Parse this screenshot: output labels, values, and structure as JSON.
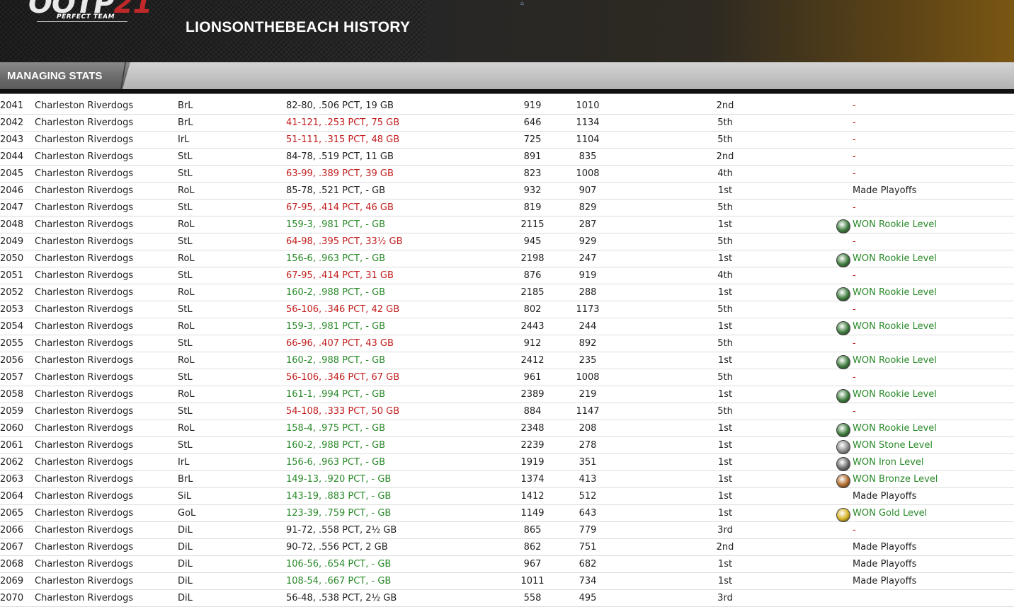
{
  "header": {
    "logo_main": "OOTP",
    "logo_num": "21",
    "logo_sub": "PERFECT TEAM",
    "title": "LIONSONTHEBEACH HISTORY"
  },
  "tabs": [
    {
      "label": "MANAGING STATS"
    }
  ],
  "colors": {
    "good": "#2a8a2a",
    "bad": "#c21d1d"
  },
  "rows": [
    {
      "year": "2041",
      "team": "Charleston Riverdogs",
      "league": "BrL",
      "record": "82-80, .506 PCT, 19 GB",
      "rs": "919",
      "ra": "1010",
      "pos": "2nd",
      "result": "-",
      "rec_class": "neutral",
      "res_class": "bad",
      "badge": ""
    },
    {
      "year": "2042",
      "team": "Charleston Riverdogs",
      "league": "BrL",
      "record": "41-121, .253 PCT, 75 GB",
      "rs": "646",
      "ra": "1134",
      "pos": "5th",
      "result": "-",
      "rec_class": "bad",
      "res_class": "bad",
      "badge": ""
    },
    {
      "year": "2043",
      "team": "Charleston Riverdogs",
      "league": "IrL",
      "record": "51-111, .315 PCT, 48 GB",
      "rs": "725",
      "ra": "1104",
      "pos": "5th",
      "result": "-",
      "rec_class": "bad",
      "res_class": "bad",
      "badge": ""
    },
    {
      "year": "2044",
      "team": "Charleston Riverdogs",
      "league": "StL",
      "record": "84-78, .519 PCT, 11 GB",
      "rs": "891",
      "ra": "835",
      "pos": "2nd",
      "result": "-",
      "rec_class": "neutral",
      "res_class": "bad",
      "badge": ""
    },
    {
      "year": "2045",
      "team": "Charleston Riverdogs",
      "league": "StL",
      "record": "63-99, .389 PCT, 39 GB",
      "rs": "823",
      "ra": "1008",
      "pos": "4th",
      "result": "-",
      "rec_class": "bad",
      "res_class": "bad",
      "badge": ""
    },
    {
      "year": "2046",
      "team": "Charleston Riverdogs",
      "league": "RoL",
      "record": "85-78, .521 PCT, - GB",
      "rs": "932",
      "ra": "907",
      "pos": "1st",
      "result": "Made Playoffs",
      "rec_class": "neutral",
      "res_class": "neutral",
      "badge": ""
    },
    {
      "year": "2047",
      "team": "Charleston Riverdogs",
      "league": "StL",
      "record": "67-95, .414 PCT, 46 GB",
      "rs": "819",
      "ra": "829",
      "pos": "5th",
      "result": "-",
      "rec_class": "bad",
      "res_class": "bad",
      "badge": ""
    },
    {
      "year": "2048",
      "team": "Charleston Riverdogs",
      "league": "RoL",
      "record": "159-3, .981 PCT, - GB",
      "rs": "2115",
      "ra": "287",
      "pos": "1st",
      "result": "WON Rookie Level",
      "rec_class": "good",
      "res_class": "good",
      "badge": "rookie"
    },
    {
      "year": "2049",
      "team": "Charleston Riverdogs",
      "league": "StL",
      "record": "64-98, .395 PCT, 33½ GB",
      "rs": "945",
      "ra": "929",
      "pos": "5th",
      "result": "-",
      "rec_class": "bad",
      "res_class": "bad",
      "badge": ""
    },
    {
      "year": "2050",
      "team": "Charleston Riverdogs",
      "league": "RoL",
      "record": "156-6, .963 PCT, - GB",
      "rs": "2198",
      "ra": "247",
      "pos": "1st",
      "result": "WON Rookie Level",
      "rec_class": "good",
      "res_class": "good",
      "badge": "rookie"
    },
    {
      "year": "2051",
      "team": "Charleston Riverdogs",
      "league": "StL",
      "record": "67-95, .414 PCT, 31 GB",
      "rs": "876",
      "ra": "919",
      "pos": "4th",
      "result": "-",
      "rec_class": "bad",
      "res_class": "bad",
      "badge": ""
    },
    {
      "year": "2052",
      "team": "Charleston Riverdogs",
      "league": "RoL",
      "record": "160-2, .988 PCT, - GB",
      "rs": "2185",
      "ra": "288",
      "pos": "1st",
      "result": "WON Rookie Level",
      "rec_class": "good",
      "res_class": "good",
      "badge": "rookie"
    },
    {
      "year": "2053",
      "team": "Charleston Riverdogs",
      "league": "StL",
      "record": "56-106, .346 PCT, 42 GB",
      "rs": "802",
      "ra": "1173",
      "pos": "5th",
      "result": "-",
      "rec_class": "bad",
      "res_class": "bad",
      "badge": ""
    },
    {
      "year": "2054",
      "team": "Charleston Riverdogs",
      "league": "RoL",
      "record": "159-3, .981 PCT, - GB",
      "rs": "2443",
      "ra": "244",
      "pos": "1st",
      "result": "WON Rookie Level",
      "rec_class": "good",
      "res_class": "good",
      "badge": "rookie"
    },
    {
      "year": "2055",
      "team": "Charleston Riverdogs",
      "league": "StL",
      "record": "66-96, .407 PCT, 43 GB",
      "rs": "912",
      "ra": "892",
      "pos": "5th",
      "result": "-",
      "rec_class": "bad",
      "res_class": "bad",
      "badge": ""
    },
    {
      "year": "2056",
      "team": "Charleston Riverdogs",
      "league": "RoL",
      "record": "160-2, .988 PCT, - GB",
      "rs": "2412",
      "ra": "235",
      "pos": "1st",
      "result": "WON Rookie Level",
      "rec_class": "good",
      "res_class": "good",
      "badge": "rookie"
    },
    {
      "year": "2057",
      "team": "Charleston Riverdogs",
      "league": "StL",
      "record": "56-106, .346 PCT, 67 GB",
      "rs": "961",
      "ra": "1008",
      "pos": "5th",
      "result": "-",
      "rec_class": "bad",
      "res_class": "bad",
      "badge": ""
    },
    {
      "year": "2058",
      "team": "Charleston Riverdogs",
      "league": "RoL",
      "record": "161-1, .994 PCT, - GB",
      "rs": "2389",
      "ra": "219",
      "pos": "1st",
      "result": "WON Rookie Level",
      "rec_class": "good",
      "res_class": "good",
      "badge": "rookie"
    },
    {
      "year": "2059",
      "team": "Charleston Riverdogs",
      "league": "StL",
      "record": "54-108, .333 PCT, 50 GB",
      "rs": "884",
      "ra": "1147",
      "pos": "5th",
      "result": "-",
      "rec_class": "bad",
      "res_class": "bad",
      "badge": ""
    },
    {
      "year": "2060",
      "team": "Charleston Riverdogs",
      "league": "RoL",
      "record": "158-4, .975 PCT, - GB",
      "rs": "2348",
      "ra": "208",
      "pos": "1st",
      "result": "WON Rookie Level",
      "rec_class": "good",
      "res_class": "good",
      "badge": "rookie"
    },
    {
      "year": "2061",
      "team": "Charleston Riverdogs",
      "league": "StL",
      "record": "160-2, .988 PCT, - GB",
      "rs": "2239",
      "ra": "278",
      "pos": "1st",
      "result": "WON Stone Level",
      "rec_class": "good",
      "res_class": "good",
      "badge": "stone"
    },
    {
      "year": "2062",
      "team": "Charleston Riverdogs",
      "league": "IrL",
      "record": "156-6, .963 PCT, - GB",
      "rs": "1919",
      "ra": "351",
      "pos": "1st",
      "result": "WON Iron Level",
      "rec_class": "good",
      "res_class": "good",
      "badge": "iron"
    },
    {
      "year": "2063",
      "team": "Charleston Riverdogs",
      "league": "BrL",
      "record": "149-13, .920 PCT, - GB",
      "rs": "1374",
      "ra": "413",
      "pos": "1st",
      "result": "WON Bronze Level",
      "rec_class": "good",
      "res_class": "good",
      "badge": "bronze"
    },
    {
      "year": "2064",
      "team": "Charleston Riverdogs",
      "league": "SiL",
      "record": "143-19, .883 PCT, - GB",
      "rs": "1412",
      "ra": "512",
      "pos": "1st",
      "result": "Made Playoffs",
      "rec_class": "good",
      "res_class": "neutral",
      "badge": ""
    },
    {
      "year": "2065",
      "team": "Charleston Riverdogs",
      "league": "GoL",
      "record": "123-39, .759 PCT, - GB",
      "rs": "1149",
      "ra": "643",
      "pos": "1st",
      "result": "WON Gold Level",
      "rec_class": "good",
      "res_class": "good",
      "badge": "gold"
    },
    {
      "year": "2066",
      "team": "Charleston Riverdogs",
      "league": "DiL",
      "record": "91-72, .558 PCT, 2½ GB",
      "rs": "865",
      "ra": "779",
      "pos": "3rd",
      "result": "-",
      "rec_class": "neutral",
      "res_class": "bad",
      "badge": ""
    },
    {
      "year": "2067",
      "team": "Charleston Riverdogs",
      "league": "DiL",
      "record": "90-72, .556 PCT, 2 GB",
      "rs": "862",
      "ra": "751",
      "pos": "2nd",
      "result": "Made Playoffs",
      "rec_class": "neutral",
      "res_class": "neutral",
      "badge": ""
    },
    {
      "year": "2068",
      "team": "Charleston Riverdogs",
      "league": "DiL",
      "record": "106-56, .654 PCT, - GB",
      "rs": "967",
      "ra": "682",
      "pos": "1st",
      "result": "Made Playoffs",
      "rec_class": "good",
      "res_class": "neutral",
      "badge": ""
    },
    {
      "year": "2069",
      "team": "Charleston Riverdogs",
      "league": "DiL",
      "record": "108-54, .667 PCT, - GB",
      "rs": "1011",
      "ra": "734",
      "pos": "1st",
      "result": "Made Playoffs",
      "rec_class": "good",
      "res_class": "neutral",
      "badge": ""
    },
    {
      "year": "2070",
      "team": "Charleston Riverdogs",
      "league": "DiL",
      "record": "56-48, .538 PCT, 2½ GB",
      "rs": "558",
      "ra": "495",
      "pos": "3rd",
      "result": "",
      "rec_class": "neutral",
      "res_class": "neutral",
      "badge": ""
    }
  ],
  "badge_colors": {
    "rookie": "#3c7a3c",
    "stone": "#8a8a8a",
    "iron": "#6a6a6a",
    "bronze": "#b06a2a",
    "gold": "#d4b020"
  }
}
